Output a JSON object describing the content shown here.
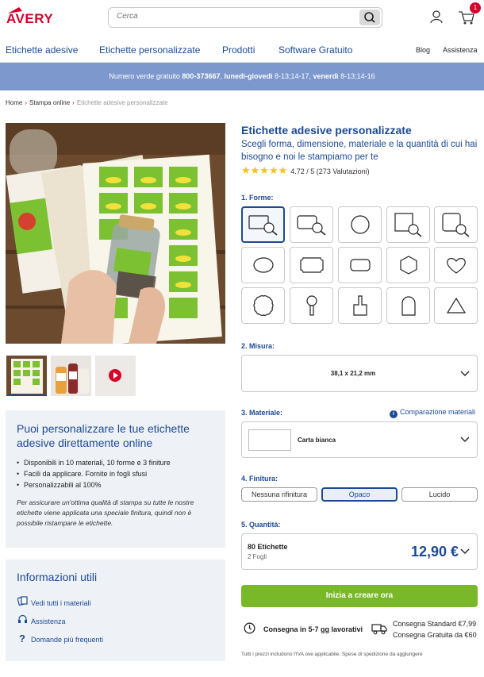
{
  "header": {
    "logo_text": "AVERY",
    "search_placeholder": "Cerca",
    "cart_count": "1"
  },
  "nav": {
    "items": [
      "Etichette adesive",
      "Etichette personalizzate",
      "Prodotti",
      "Software Gratuito"
    ],
    "blog": "Blog",
    "assistenza": "Assistenza"
  },
  "promo": {
    "prefix": "Numero verde gratuito ",
    "phone": "800-373667",
    "sep1": ", ",
    "days1": "lunedì-giovedì",
    "hours1": " 8-13;14-17, ",
    "days2": "venerdì",
    "hours2": " 8-13;14-16"
  },
  "breadcrumb": {
    "home": "Home",
    "level2": "Stampa online",
    "current": "Etichette adesive personalizzate"
  },
  "info_box": {
    "title": "Puoi personalizzare le tue etichette adesive direttamente online",
    "bullets": [
      "Disponibili in 10 materiali, 10 forme e 3 finiture",
      "Facili da applicare. Fornite in fogli sfusi",
      "Personalizzabili al 100%"
    ],
    "note": "Per assicurare un'ottima qualità di stampa su tutte le nostre etichette viene applicata una speciale finitura, quindi non è possibile ristampare le etichette."
  },
  "useful": {
    "title": "Informazioni utili",
    "items": [
      "Vedi tutti i materiali",
      "Assistenza",
      "Domande più frequenti"
    ]
  },
  "product": {
    "title": "Etichette adesive personalizzate",
    "subtitle": "Scegli forma, dimensione, materiale e la quantità di cui hai bisogno e noi le stampiamo per te",
    "stars": "★★★★★",
    "rating": "4.72 / 5 (273 Valutazioni)",
    "rating_value": 4.72
  },
  "forms": {
    "label": "1. Forme:",
    "selected_index": 0,
    "shapes": [
      "rectangle-custom",
      "rectangle-round-custom",
      "circle",
      "square-custom",
      "square-round-custom",
      "oval",
      "notched-rectangle",
      "rounded-rectangle",
      "hexagon",
      "heart",
      "scalloped-circle",
      "tag-keyhole",
      "bottle",
      "arch",
      "triangle"
    ]
  },
  "size": {
    "label": "2. Misura:",
    "value": "38,1 x 21,2 mm"
  },
  "material": {
    "label": "3. Materiale:",
    "compare": "Comparazione materiali",
    "value": "Carta bianca"
  },
  "finish": {
    "label": "4. Finitura:",
    "options": [
      "Nessuna rifinitura",
      "Opaco",
      "Lucido"
    ],
    "selected": "Opaco"
  },
  "quantity": {
    "label": "5. Quantità:",
    "value": "80 Etichette",
    "sheets": "2 Fogli",
    "price": "12,90 €"
  },
  "cta": "Inizia a creare ora",
  "delivery": {
    "text": "Consegna in 5-7 gg lavorativi",
    "standard": "Consegna Standard €7,99",
    "free": "Consegna Gratuita da €60"
  },
  "footnote": "Tutti i prezzi includono l'IVA ove applicabile. Spese di spedizione da aggiungere",
  "colors": {
    "brand_red": "#d6002a",
    "brand_blue": "#1b4a96",
    "promo_bar": "#7d98cd",
    "cta_green": "#79b828",
    "star": "#f3c21b"
  }
}
